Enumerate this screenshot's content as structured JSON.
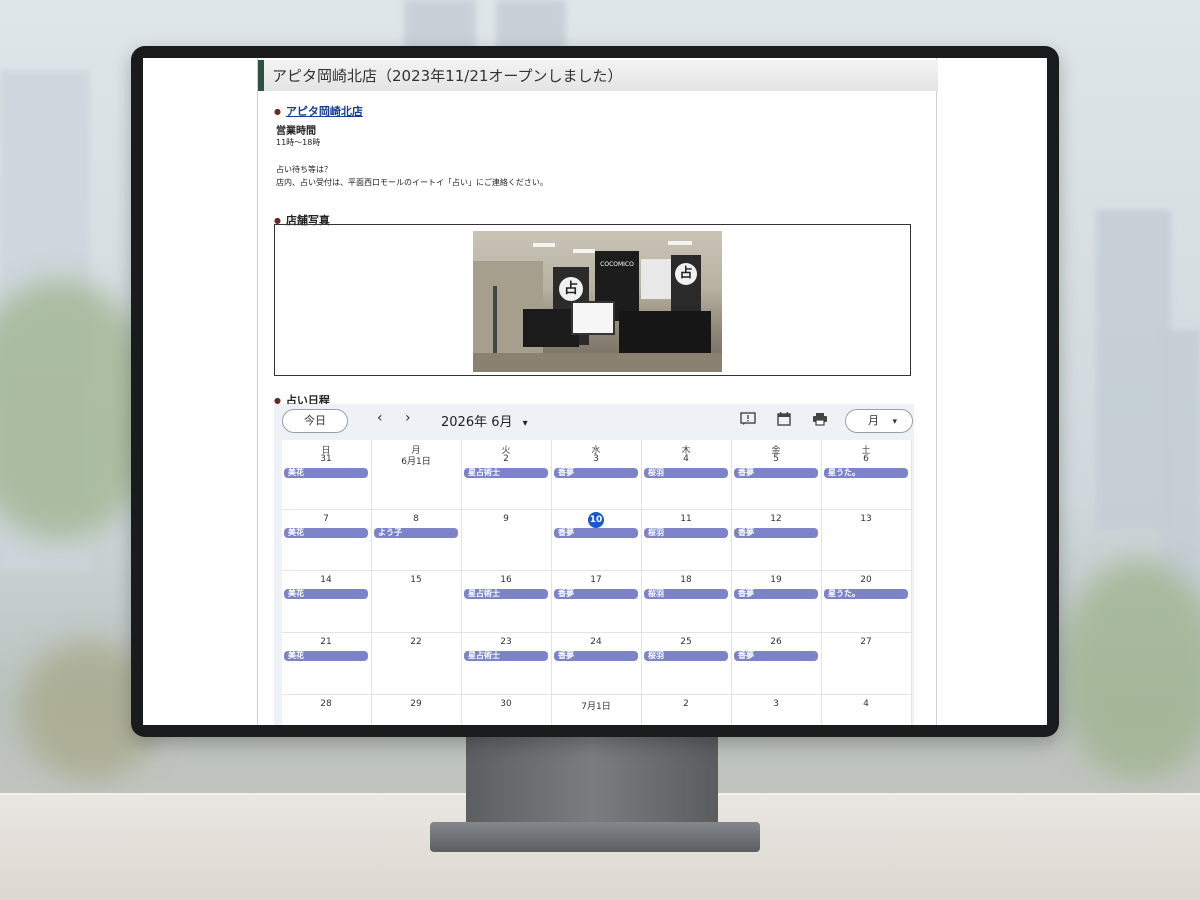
{
  "page": {
    "title": "アピタ岡崎北店（2023年11/21オープンしました）",
    "store_link": "アピタ岡崎北店",
    "hours_heading": "営業時間",
    "hours_value": "11時〜18時",
    "note_line1": "占い待ち等は？",
    "note_line2": "店内、占い受付は、平面西口モールのイートイ「占い」にご連絡ください。",
    "photo_heading": "店舗写真",
    "schedule_heading": "占い日程"
  },
  "calendar": {
    "today_button": "今日",
    "prev": "‹",
    "next": "›",
    "month_label": "2026年 6月",
    "month_caret": "▾",
    "view_label": "月",
    "view_caret": "▾",
    "weekdays": [
      "日",
      "月",
      "火",
      "水",
      "木",
      "金",
      "土"
    ],
    "weeks": [
      [
        {
          "day": "31",
          "event": "美花"
        },
        {
          "day": "6月1日",
          "event": ""
        },
        {
          "day": "2",
          "event": "星占術士"
        },
        {
          "day": "3",
          "event": "香夢"
        },
        {
          "day": "4",
          "event": "桜羽"
        },
        {
          "day": "5",
          "event": "香夢"
        },
        {
          "day": "6",
          "event": "星うた。"
        }
      ],
      [
        {
          "day": "7",
          "event": "美花"
        },
        {
          "day": "8",
          "event": "よう子"
        },
        {
          "day": "9",
          "event": ""
        },
        {
          "day": "10",
          "event": "香夢",
          "today": true
        },
        {
          "day": "11",
          "event": "桜羽"
        },
        {
          "day": "12",
          "event": "香夢"
        },
        {
          "day": "13",
          "event": ""
        }
      ],
      [
        {
          "day": "14",
          "event": "美花"
        },
        {
          "day": "15",
          "event": ""
        },
        {
          "day": "16",
          "event": "星占術士"
        },
        {
          "day": "17",
          "event": "香夢"
        },
        {
          "day": "18",
          "event": "桜羽"
        },
        {
          "day": "19",
          "event": "香夢"
        },
        {
          "day": "20",
          "event": "星うた。"
        }
      ],
      [
        {
          "day": "21",
          "event": "美花"
        },
        {
          "day": "22",
          "event": ""
        },
        {
          "day": "23",
          "event": "星占術士"
        },
        {
          "day": "24",
          "event": "香夢"
        },
        {
          "day": "25",
          "event": "桜羽"
        },
        {
          "day": "26",
          "event": "香夢"
        },
        {
          "day": "27",
          "event": ""
        }
      ],
      [
        {
          "day": "28",
          "event": ""
        },
        {
          "day": "29",
          "event": ""
        },
        {
          "day": "30",
          "event": ""
        },
        {
          "day": "7月1日",
          "event": ""
        },
        {
          "day": "2",
          "event": ""
        },
        {
          "day": "3",
          "event": ""
        },
        {
          "day": "4",
          "event": ""
        }
      ]
    ],
    "event_color": "#7c83c8",
    "today_color": "#1a57c8"
  },
  "photo": {
    "sign_text": "COCOMICO",
    "sign_glyph": "占"
  },
  "icons": [
    "feedback-icon",
    "calendar-icon",
    "print-icon"
  ]
}
